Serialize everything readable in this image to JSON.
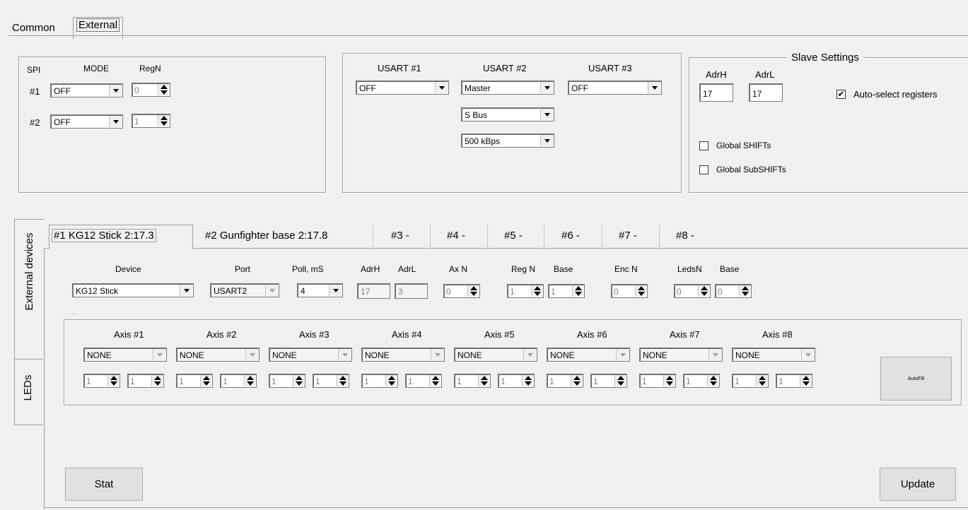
{
  "top_tabs": {
    "common": "Common",
    "external": "External"
  },
  "spi": {
    "header_spi": "SPI",
    "header_mode": "MODE",
    "header_regn": "RegN",
    "rows": [
      {
        "label": "#1",
        "mode": "OFF",
        "regn": "0"
      },
      {
        "label": "#2",
        "mode": "OFF",
        "regn": "1"
      }
    ]
  },
  "usart": {
    "u1_label": "USART #1",
    "u2_label": "USART #2",
    "u3_label": "USART #3",
    "u1_value": "OFF",
    "u2_value": "Master",
    "u3_value": "OFF",
    "u2_protocol": "S Bus",
    "u2_speed": "500 kBps"
  },
  "slave": {
    "title": "Slave Settings",
    "adrh_label": "AdrH",
    "adrl_label": "AdrL",
    "adrh": "17",
    "adrl": "17",
    "auto_select_label": "Auto-select registers",
    "auto_select_checked": "✔",
    "global_shifts_label": "Global SHIFTs",
    "global_subshifts_label": "Global SubSHIFTs"
  },
  "side_tabs": {
    "external_devices": "External devices",
    "leds": "LEDs"
  },
  "device_tabs": [
    "#1 KG12 Stick 2:17.3",
    "#2 Gunfighter base 2:17.8",
    "#3 -",
    "#4 -",
    "#5 -",
    "#6 -",
    "#7 -",
    "#8 -"
  ],
  "device": {
    "device_label": "Device",
    "port_label": "Port",
    "poll_label": "Poll, mS",
    "adrh_label": "AdrH",
    "adrl_label": "AdrL",
    "axn_label": "Ax N",
    "regn_label": "Reg N",
    "base_label": "Base",
    "encn_label": "Enc N",
    "ledsn_label": "LedsN",
    "base2_label": "Base",
    "device": "KG12 Stick",
    "port": "USART2",
    "poll": "4",
    "adrh": "17",
    "adrl": "3",
    "axn": "0",
    "regn": "1",
    "base": "1",
    "encn": "0",
    "ledsn": "0",
    "base2": "0"
  },
  "axes_group_label": "...",
  "axes": [
    {
      "label": "Axis #1",
      "value": "NONE",
      "a": "1",
      "b": "1"
    },
    {
      "label": "Axis #2",
      "value": "NONE",
      "a": "1",
      "b": "1"
    },
    {
      "label": "Axis #3",
      "value": "NONE",
      "a": "1",
      "b": "1"
    },
    {
      "label": "Axis #4",
      "value": "NONE",
      "a": "1",
      "b": "1"
    },
    {
      "label": "Axis #5",
      "value": "NONE",
      "a": "1",
      "b": "1"
    },
    {
      "label": "Axis #6",
      "value": "NONE",
      "a": "1",
      "b": "1"
    },
    {
      "label": "Axis #7",
      "value": "NONE",
      "a": "1",
      "b": "1"
    },
    {
      "label": "Axis #8",
      "value": "NONE",
      "a": "1",
      "b": "1"
    }
  ],
  "buttons": {
    "autofill": "AutoFill",
    "stat": "Stat",
    "update": "Update"
  }
}
